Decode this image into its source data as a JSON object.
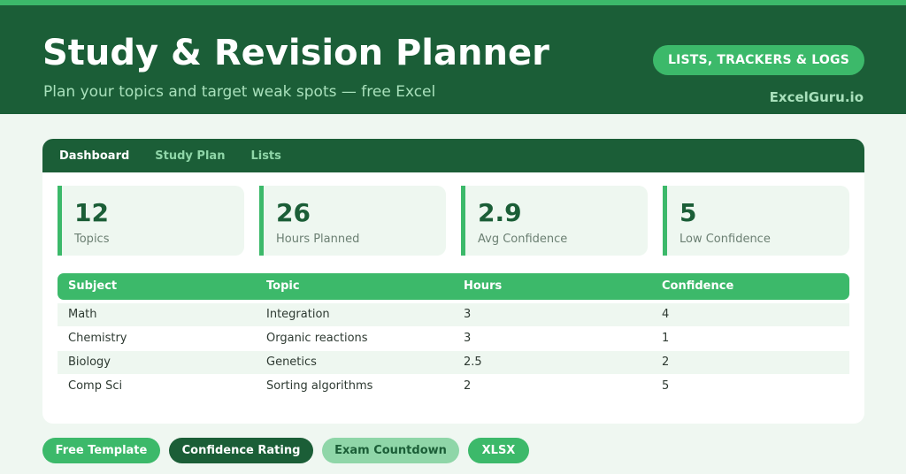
{
  "header": {
    "title": "Study & Revision Planner",
    "subtitle": "Plan your topics and target weak spots — free Excel",
    "category": "LISTS, TRACKERS & LOGS",
    "brand": "ExcelGuru.io"
  },
  "tabs": [
    {
      "label": "Dashboard",
      "active": true
    },
    {
      "label": "Study Plan",
      "active": false
    },
    {
      "label": "Lists",
      "active": false
    }
  ],
  "stats": [
    {
      "value": "12",
      "label": "Topics"
    },
    {
      "value": "26",
      "label": "Hours Planned"
    },
    {
      "value": "2.9",
      "label": "Avg Confidence"
    },
    {
      "value": "5",
      "label": "Low Confidence"
    }
  ],
  "table": {
    "columns": [
      "Subject",
      "Topic",
      "Hours",
      "Confidence"
    ],
    "rows": [
      [
        "Math",
        "Integration",
        "3",
        "4"
      ],
      [
        "Chemistry",
        "Organic reactions",
        "3",
        "1"
      ],
      [
        "Biology",
        "Genetics",
        "2.5",
        "2"
      ],
      [
        "Comp Sci",
        "Sorting algorithms",
        "2",
        "5"
      ]
    ]
  },
  "tags": [
    "Free Template",
    "Confidence Rating",
    "Exam Countdown",
    "XLSX"
  ],
  "colors": {
    "dark_green": "#1b5e37",
    "accent_green": "#3cb96a",
    "light_green": "#8fd6a8",
    "background": "#eff7f1"
  }
}
